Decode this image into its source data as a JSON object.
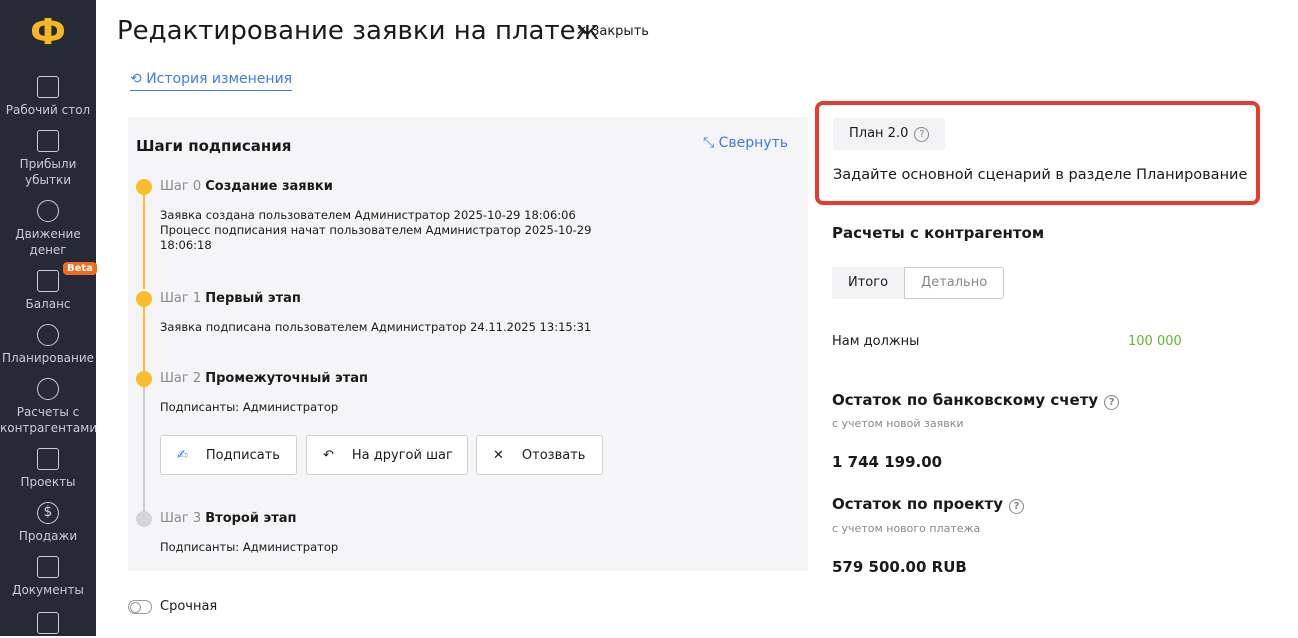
{
  "sidebar": {
    "logo": "Ф",
    "items": [
      {
        "label": "Рабочий стол"
      },
      {
        "label": "Прибыли убытки"
      },
      {
        "label": "Движение денег"
      },
      {
        "label": "Баланс",
        "badge": "Beta"
      },
      {
        "label": "Планирование"
      },
      {
        "label": "Расчеты с контрагентами"
      },
      {
        "label": "Проекты"
      },
      {
        "label": "Продажи"
      },
      {
        "label": "Документы"
      }
    ]
  },
  "header": {
    "title": "Редактирование заявки на платеж",
    "close": "Закрыть",
    "history": "История изменения"
  },
  "steps": {
    "title": "Шаги подписания",
    "collapse": "Свернуть",
    "items": [
      {
        "num": "Шаг 0",
        "name": "Создание заявки",
        "lines": [
          "Заявка создана пользователем Администратор 2025-10-29 18:06:06",
          "Процесс подписания начат пользователем Администратор 2025-10-29",
          "18:06:18"
        ]
      },
      {
        "num": "Шаг 1",
        "name": "Первый этап",
        "lines": [
          "Заявка подписана пользователем Администратор 24.11.2025 13:15:31"
        ]
      },
      {
        "num": "Шаг 2",
        "name": "Промежуточный этап",
        "lines": [
          "Подписанты: Администратор"
        ]
      },
      {
        "num": "Шаг 3",
        "name": "Второй этап",
        "lines": [
          "Подписанты: Администратор"
        ]
      }
    ],
    "buttons": {
      "sign": "Подписать",
      "other": "На другой шаг",
      "revoke": "Отозвать"
    }
  },
  "urgent": "Срочная",
  "plan": {
    "badge": "План 2.0",
    "message": "Задайте основной сценарий в разделе Планирование"
  },
  "settlements": {
    "title": "Расчеты с контрагентом",
    "tabs": [
      "Итого",
      "Детально"
    ],
    "owed_label": "Нам должны",
    "owed_value": "100 000"
  },
  "bank": {
    "title": "Остаток по банковскому счету",
    "sub": "с учетом новой заявки",
    "value": "1 744 199.00"
  },
  "project": {
    "title": "Остаток по проекту",
    "sub": "с учетом нового платежа",
    "value": "579 500.00 RUB"
  },
  "colors": {
    "accent": "#3d7bf0",
    "step": "#fbbd2e",
    "positive": "#5cb82e",
    "highlight": "#e53c32"
  }
}
